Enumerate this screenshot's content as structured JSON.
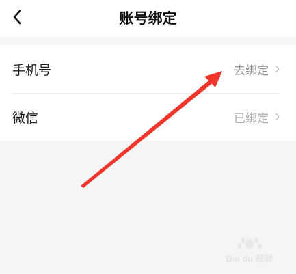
{
  "header": {
    "title": "账号绑定",
    "back_icon": "chevron-left-icon"
  },
  "bindings": [
    {
      "label": "手机号",
      "status": "去绑定",
      "bound": false
    },
    {
      "label": "微信",
      "status": "已绑定",
      "bound": true
    }
  ],
  "colors": {
    "arrow": "#f0362b",
    "label": "#1a1a1a",
    "status": "#8c8c8c",
    "background": "#f5f5f5"
  },
  "watermark": {
    "text": "Bai du 经验"
  }
}
